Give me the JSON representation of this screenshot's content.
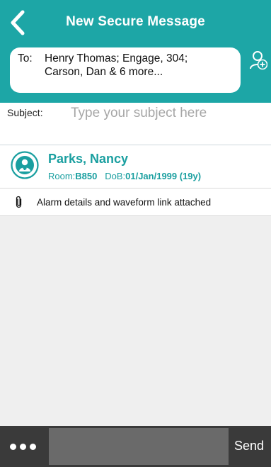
{
  "header": {
    "title": "New Secure Message",
    "back_icon": "chevron-left-icon",
    "add_recipient_icon": "add-contact-icon"
  },
  "recipients": {
    "label": "To:",
    "value": "Henry Thomas; Engage, 304;\nCarson, Dan & 6 more..."
  },
  "subject": {
    "label": "Subject:",
    "placeholder": "Type your subject here",
    "value": ""
  },
  "patient": {
    "name": "Parks, Nancy",
    "room_label": "Room:",
    "room_value": "B850",
    "dob_label": "DoB:",
    "dob_value": "01/Jan/1999 (19y)",
    "avatar_icon": "patient-avatar-icon"
  },
  "attachment": {
    "icon": "paperclip-icon",
    "text": "Alarm details and waveform link attached"
  },
  "composer": {
    "more_icon": "more-dots-icon",
    "message_value": "",
    "send_label": "Send"
  },
  "colors": {
    "accent": "#1da6a6",
    "patient_text": "#1a9fa0",
    "bottom_bar": "#3a3a3a",
    "message_field": "#6a6a6a",
    "placeholder": "#a6a6a6"
  }
}
